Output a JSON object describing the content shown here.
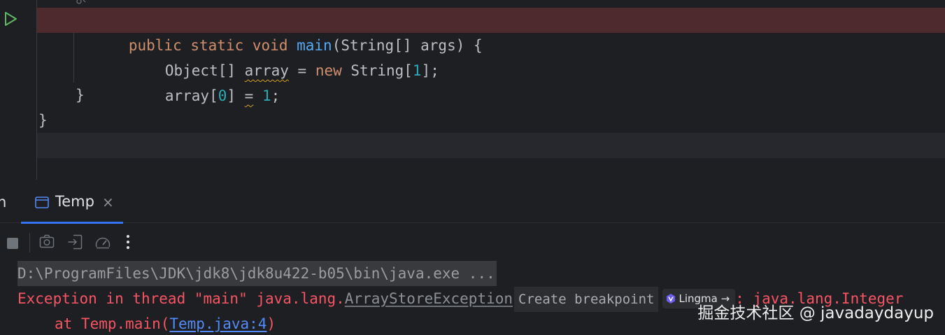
{
  "editor": {
    "lines": {
      "signature": {
        "kw1": "public",
        "kw2": "static",
        "kw3": "void",
        "method": "main",
        "rest": "(String[] args) {"
      },
      "decl": {
        "type": "Object[] ",
        "var": "array",
        "eq": " = ",
        "kw_new": "new",
        "type2": " String[",
        "num": "1",
        "end": "];"
      },
      "assign": {
        "var": "array[",
        "idx": "0",
        "mid": "] ",
        "eq": "=",
        "sp": " ",
        "num": "1",
        "end": ";"
      },
      "close_method": "}",
      "close_class": "}"
    },
    "icons": {
      "run": "run-gutter-icon"
    },
    "colors": {
      "error_line_bg": "#4e2a2e",
      "keyword": "#cf8e6d",
      "method": "#56a8f5",
      "number": "#2aacb8"
    }
  },
  "run_window": {
    "left_tab_fragment": "n",
    "tab": {
      "label": "Temp",
      "close": "×",
      "icon": "console-icon"
    },
    "toolbar": {
      "icons": [
        "stop-icon",
        "camera-icon",
        "exit-icon",
        "gauge-icon",
        "more-vertical-icon"
      ]
    },
    "console": {
      "command": "D:\\ProgramFiles\\JDK\\jdk8\\jdk8u422-b05\\bin\\java.exe ...",
      "exception_prefix": "Exception in thread \"main\" java.lang.",
      "exception_class": "ArrayStoreException",
      "create_breakpoint": "Create breakpoint",
      "lingma_label": "Lingma",
      "lingma_arrow": "→",
      "exception_suffix": ": java.lang.Integer",
      "at_prefix": "at Temp.main(",
      "at_link": "Temp.java:4",
      "at_suffix": ")"
    }
  },
  "watermark": "掘金技术社区 @ javadaydayup"
}
